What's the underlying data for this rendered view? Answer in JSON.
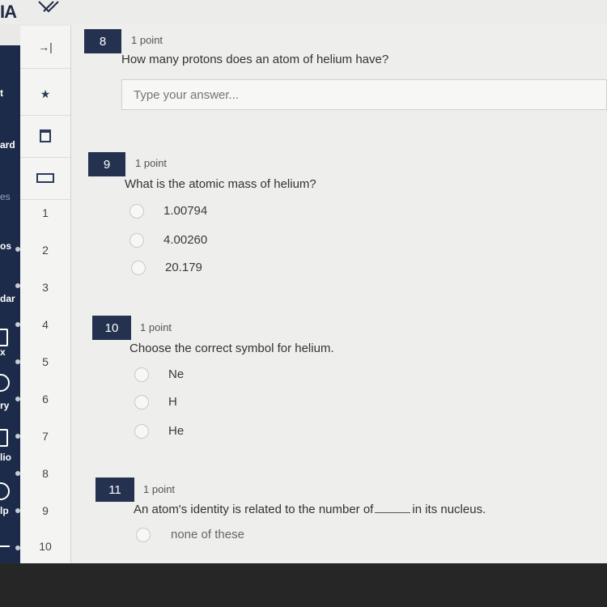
{
  "app": {
    "logo_text": "IA"
  },
  "leftnav": {
    "items": [
      {
        "label": "t"
      },
      {
        "label": "ard"
      },
      {
        "label": "es"
      },
      {
        "label": "os"
      },
      {
        "label": "dar"
      },
      {
        "label": "x"
      },
      {
        "label": "ry"
      },
      {
        "label": "lio"
      },
      {
        "label": "lp"
      }
    ]
  },
  "palette": {
    "tools": [
      {
        "icon": "collapse-arrow-icon",
        "glyph": "→|"
      },
      {
        "icon": "pin-icon",
        "glyph": "★"
      },
      {
        "icon": "bookmark-icon",
        "glyph": ""
      },
      {
        "icon": "card-icon",
        "glyph": ""
      }
    ],
    "numbers": [
      "1",
      "2",
      "3",
      "4",
      "5",
      "6",
      "7",
      "8",
      "9",
      "10"
    ]
  },
  "questions": [
    {
      "number": "8",
      "points": "1 point",
      "text": "How many protons does an atom of helium have?",
      "placeholder": "Type your answer..."
    },
    {
      "number": "9",
      "points": "1 point",
      "text": "What is the atomic mass of helium?",
      "options": [
        "1.00794",
        "4.00260",
        "20.179"
      ]
    },
    {
      "number": "10",
      "points": "1 point",
      "text": "Choose the correct symbol for helium.",
      "options": [
        "Ne",
        "H",
        "He"
      ]
    },
    {
      "number": "11",
      "points": "1 point",
      "text_before": "An atom's identity is related to the number of",
      "text_after": "in its nucleus.",
      "options": [
        "none of these"
      ]
    }
  ],
  "colors": {
    "nav_bg": "#1d2b4a",
    "badge_bg": "#243250",
    "page_bg": "#eeeeec"
  }
}
